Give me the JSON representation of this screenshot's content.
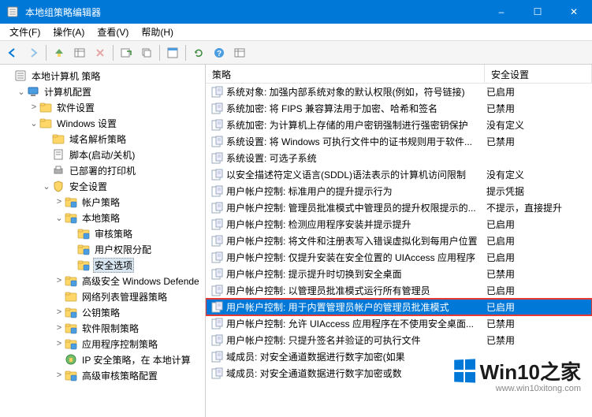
{
  "window": {
    "title": "本地组策略编辑器",
    "buttons": {
      "min": "–",
      "max": "☐",
      "close": "✕"
    }
  },
  "menubar": [
    {
      "label": "文件(F)"
    },
    {
      "label": "操作(A)"
    },
    {
      "label": "查看(V)"
    },
    {
      "label": "帮助(H)"
    }
  ],
  "tree": [
    {
      "depth": 0,
      "expander": "",
      "icon": "gpo",
      "label": "本地计算机 策略",
      "selected": false
    },
    {
      "depth": 1,
      "expander": "⌄",
      "icon": "computer",
      "label": "计算机配置",
      "selected": false
    },
    {
      "depth": 2,
      "expander": ">",
      "icon": "folder",
      "label": "软件设置",
      "selected": false
    },
    {
      "depth": 2,
      "expander": "⌄",
      "icon": "folder",
      "label": "Windows 设置",
      "selected": false
    },
    {
      "depth": 3,
      "expander": "",
      "icon": "folder",
      "label": "域名解析策略",
      "selected": false
    },
    {
      "depth": 3,
      "expander": "",
      "icon": "script",
      "label": "脚本(启动/关机)",
      "selected": false
    },
    {
      "depth": 3,
      "expander": "",
      "icon": "printer",
      "label": "已部署的打印机",
      "selected": false
    },
    {
      "depth": 3,
      "expander": "⌄",
      "icon": "security",
      "label": "安全设置",
      "selected": false
    },
    {
      "depth": 4,
      "expander": ">",
      "icon": "folder-blue",
      "label": "帐户策略",
      "selected": false
    },
    {
      "depth": 4,
      "expander": "⌄",
      "icon": "folder-blue",
      "label": "本地策略",
      "selected": false
    },
    {
      "depth": 5,
      "expander": "",
      "icon": "folder-blue",
      "label": "审核策略",
      "selected": false
    },
    {
      "depth": 5,
      "expander": "",
      "icon": "folder-blue",
      "label": "用户权限分配",
      "selected": false
    },
    {
      "depth": 5,
      "expander": "",
      "icon": "folder-blue",
      "label": "安全选项",
      "selected": true
    },
    {
      "depth": 4,
      "expander": ">",
      "icon": "folder-blue",
      "label": "高级安全 Windows Defende",
      "selected": false
    },
    {
      "depth": 4,
      "expander": "",
      "icon": "folder",
      "label": "网络列表管理器策略",
      "selected": false
    },
    {
      "depth": 4,
      "expander": ">",
      "icon": "folder-blue",
      "label": "公钥策略",
      "selected": false
    },
    {
      "depth": 4,
      "expander": ">",
      "icon": "folder-blue",
      "label": "软件限制策略",
      "selected": false
    },
    {
      "depth": 4,
      "expander": ">",
      "icon": "folder-blue",
      "label": "应用程序控制策略",
      "selected": false
    },
    {
      "depth": 4,
      "expander": "",
      "icon": "ipsec",
      "label": "IP 安全策略，在 本地计算",
      "selected": false
    },
    {
      "depth": 4,
      "expander": ">",
      "icon": "folder-blue",
      "label": "高级审核策略配置",
      "selected": false
    }
  ],
  "list": {
    "columns": {
      "name": "策略",
      "setting": "安全设置"
    },
    "rows": [
      {
        "name": "系统对象: 加强内部系统对象的默认权限(例如，符号链接)",
        "setting": "已启用",
        "selected": false
      },
      {
        "name": "系统加密: 将 FIPS 兼容算法用于加密、哈希和签名",
        "setting": "已禁用",
        "selected": false
      },
      {
        "name": "系统加密: 为计算机上存储的用户密钥强制进行强密钥保护",
        "setting": "没有定义",
        "selected": false
      },
      {
        "name": "系统设置: 将 Windows 可执行文件中的证书规则用于软件...",
        "setting": "已禁用",
        "selected": false
      },
      {
        "name": "系统设置: 可选子系统",
        "setting": "",
        "selected": false
      },
      {
        "name": "以安全描述符定义语言(SDDL)语法表示的计算机访问限制",
        "setting": "没有定义",
        "selected": false
      },
      {
        "name": "用户帐户控制: 标准用户的提升提示行为",
        "setting": "提示凭据",
        "selected": false
      },
      {
        "name": "用户帐户控制: 管理员批准模式中管理员的提升权限提示的...",
        "setting": "不提示，直接提升",
        "selected": false
      },
      {
        "name": "用户帐户控制: 检测应用程序安装并提示提升",
        "setting": "已启用",
        "selected": false
      },
      {
        "name": "用户帐户控制: 将文件和注册表写入错误虚拟化到每用户位置",
        "setting": "已启用",
        "selected": false
      },
      {
        "name": "用户帐户控制: 仅提升安装在安全位置的 UIAccess 应用程序",
        "setting": "已启用",
        "selected": false
      },
      {
        "name": "用户帐户控制: 提示提升时切换到安全桌面",
        "setting": "已禁用",
        "selected": false
      },
      {
        "name": "用户帐户控制: 以管理员批准模式运行所有管理员",
        "setting": "已启用",
        "selected": false
      },
      {
        "name": "用户帐户控制: 用于内置管理员帐户的管理员批准模式",
        "setting": "已启用",
        "selected": true
      },
      {
        "name": "用户帐户控制: 允许 UIAccess 应用程序在不使用安全桌面...",
        "setting": "已禁用",
        "selected": false
      },
      {
        "name": "用户帐户控制: 只提升签名并验证的可执行文件",
        "setting": "已禁用",
        "selected": false
      },
      {
        "name": "域成员: 对安全通道数据进行数字加密(如果",
        "setting": "",
        "selected": false
      },
      {
        "name": "域成员: 对安全通道数据进行数字加密或数",
        "setting": "",
        "selected": false
      }
    ]
  },
  "watermark": {
    "brand": "Win10之家",
    "url": "www.win10xitong.com"
  }
}
